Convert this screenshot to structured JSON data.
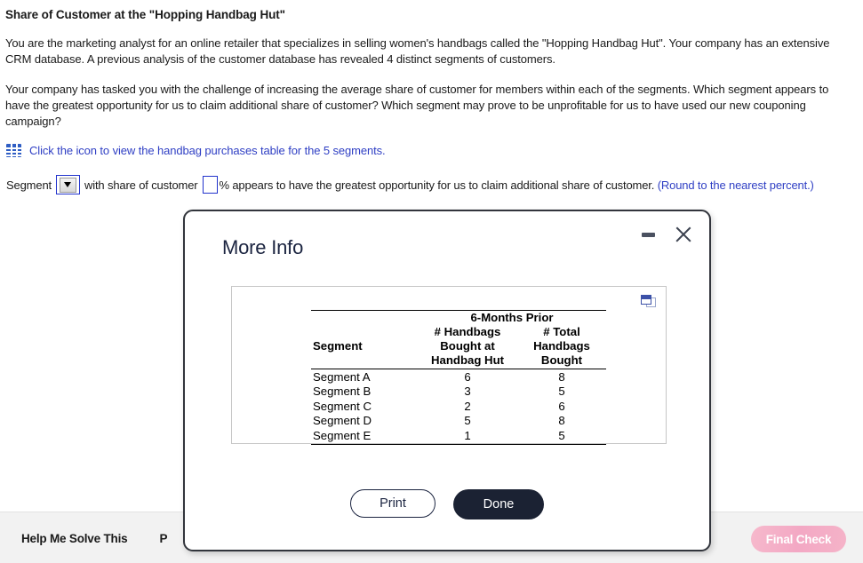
{
  "problem": {
    "title": "Share of Customer at the \"Hopping Handbag Hut\"",
    "paragraph1": "You are the marketing analyst for an online retailer that specializes in selling women's handbags called the \"Hopping Handbag Hut\". Your company has an extensive CRM database. A previous analysis of the customer database has revealed 4 distinct segments of customers.",
    "paragraph2": "Your company has tasked you with the challenge of increasing the average share of customer for members within each of the segments. Which segment appears to have the greatest opportunity for us to claim additional share of customer? Which segment may prove to be unprofitable for us to have used our new couponing campaign?",
    "icon_link_text": "Click the icon to view the handbag purchases table for the 5 segments.",
    "icon_name": "table-grid-icon",
    "answer": {
      "lead_text": "Segment",
      "dropdown_value": "",
      "mid_text": "with share of customer",
      "percent_value": "",
      "percent_symbol": "%",
      "tail_text": " appears to have the greatest opportunity for us to claim additional share of customer. ",
      "round_note": "(Round to the nearest percent.)"
    }
  },
  "modal": {
    "title": "More Info",
    "minimize_label": "minimize",
    "close_label": "close",
    "duplicate_icon": "duplicate-window-icon",
    "table": {
      "group_header": "6-Months Prior",
      "columns": [
        "Segment",
        "# Handbags\nBought at\nHandbag Hut",
        "# Total\nHandbags\nBought"
      ],
      "col1_line1": "# Handbags",
      "col1_line2": "Bought at",
      "col1_line3": "Handbag Hut",
      "col2_line1": "# Total",
      "col2_line2": "Handbags",
      "col2_line3": "Bought",
      "seg_header": "Segment",
      "rows": [
        {
          "segment": "Segment A",
          "bought_at_hut": "6",
          "total_bought": "8"
        },
        {
          "segment": "Segment B",
          "bought_at_hut": "3",
          "total_bought": "5"
        },
        {
          "segment": "Segment C",
          "bought_at_hut": "2",
          "total_bought": "6"
        },
        {
          "segment": "Segment D",
          "bought_at_hut": "5",
          "total_bought": "8"
        },
        {
          "segment": "Segment E",
          "bought_at_hut": "1",
          "total_bought": "5"
        }
      ]
    },
    "print_label": "Print",
    "done_label": "Done"
  },
  "toolbar": {
    "help_label": "Help Me Solve This",
    "second_label": "P",
    "final_check_label": "Final Check"
  },
  "colors": {
    "link_blue": "#2f3fc4",
    "icon_blue": "#2f5ec4",
    "modal_border": "#32353c",
    "done_bg": "#1b2233",
    "final_check_pink": "#f3a8c4",
    "field_border_blue": "#2233cc"
  }
}
